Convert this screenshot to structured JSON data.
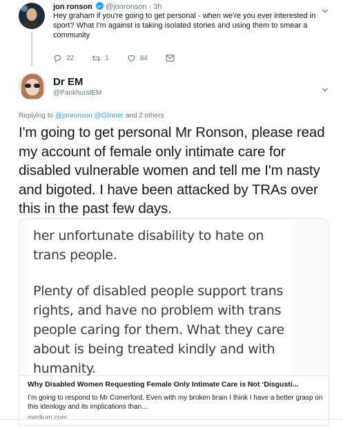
{
  "parent_tweet": {
    "name": "jon ronson",
    "handle": "@jonronson",
    "time": "3h",
    "text": "Hey graham if you're going to get personal - when we're you ever interested in sport? What I'm against is taking isolated stories and using them to smear a community",
    "actions": {
      "replies": "22",
      "retweets": "1",
      "likes": "84"
    },
    "icons": [
      "reply-icon",
      "retweet-icon",
      "heart-icon",
      "mail-icon",
      "chevron-down-icon",
      "verified-icon"
    ]
  },
  "tweet": {
    "name": "Dr EM",
    "handle": "@PankhurstEM",
    "replying_prefix": "Replying to",
    "replying_user1": "@jonronson",
    "replying_user2": "@Glinner",
    "replying_suffix": "and 2 others",
    "text": "I'm going to get personal Mr Ronson, please read my account of female only intimate care for disabled vulnerable women and tell me I'm nasty and bigoted. I have been attacked by TRAs over this in the past few days."
  },
  "card": {
    "image_text_1": "her unfortunate disability to hate on trans people.",
    "image_text_2": "Plenty of disabled people support trans rights, and have no problem with trans people caring for them. What they care about is being treated kindly and with humanity.",
    "title": "Why Disabled Women Requesting Female Only Intimate Care is Not ‘Disgusti...",
    "description": "I’m going to respond to Mr Comerford. Even with my broken brain I think I have a better grasp on this ideology and its implications than...",
    "domain": "medium.com"
  },
  "colors": {
    "link": "#1da1f2",
    "muted": "#657786",
    "text": "#14171a"
  }
}
